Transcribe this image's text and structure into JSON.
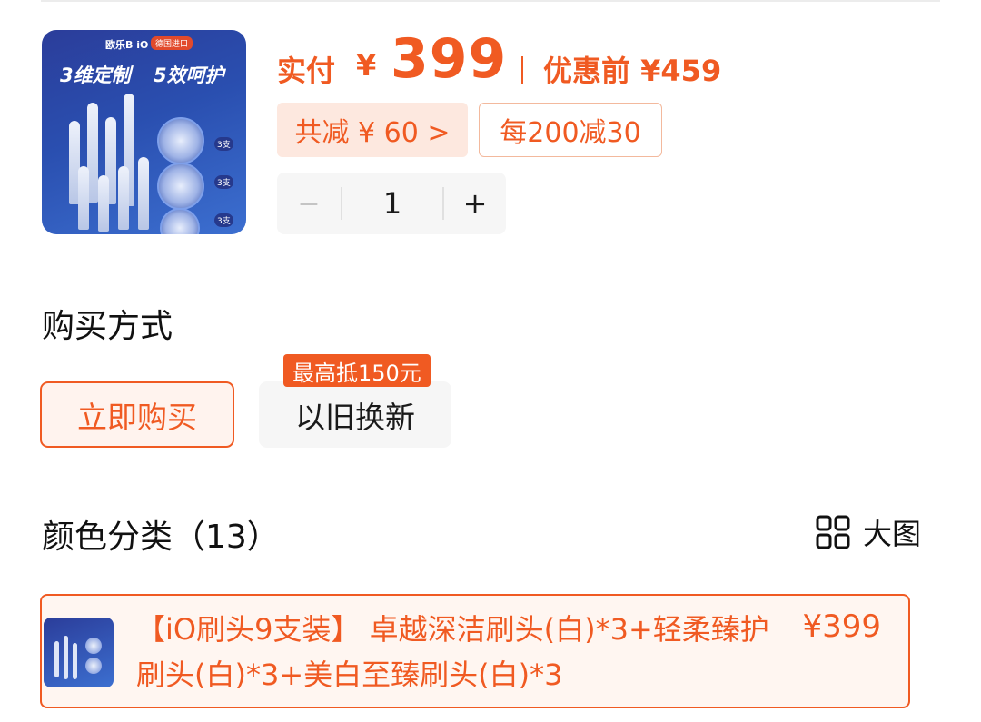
{
  "product": {
    "thumbnail": {
      "brand": "欧乐B iO",
      "tag": "德国进口",
      "headline_left": "3维定制",
      "headline_right": "5效呵护",
      "qty_labels": [
        "3支",
        "3支",
        "3支"
      ]
    },
    "price": {
      "label": "实付",
      "currency": "¥",
      "value": "399",
      "original": "优惠前 ¥459"
    },
    "discounts": {
      "total": "共减 ¥ 60 >",
      "coupon": "每200减30"
    },
    "quantity": {
      "minus": "−",
      "value": "1",
      "plus": "+"
    }
  },
  "purchase_method": {
    "title": "购买方式",
    "buy_now": "立即购买",
    "trade_in": "以旧换新",
    "trade_in_badge": "最高抵150元"
  },
  "color_category": {
    "title": "颜色分类（13）",
    "big_view_icon": "grid-icon",
    "big_view": "大图",
    "selected_variant": {
      "title": "【iO刷头9支装】 卓越深洁刷头(白)*3+轻柔臻护刷头(白)*3+美白至臻刷头(白)*3",
      "price": "¥399"
    }
  },
  "colors": {
    "accent": "#f05a22",
    "chip_bg": "#fde8df",
    "stepper_bg": "#f6f6f6"
  }
}
